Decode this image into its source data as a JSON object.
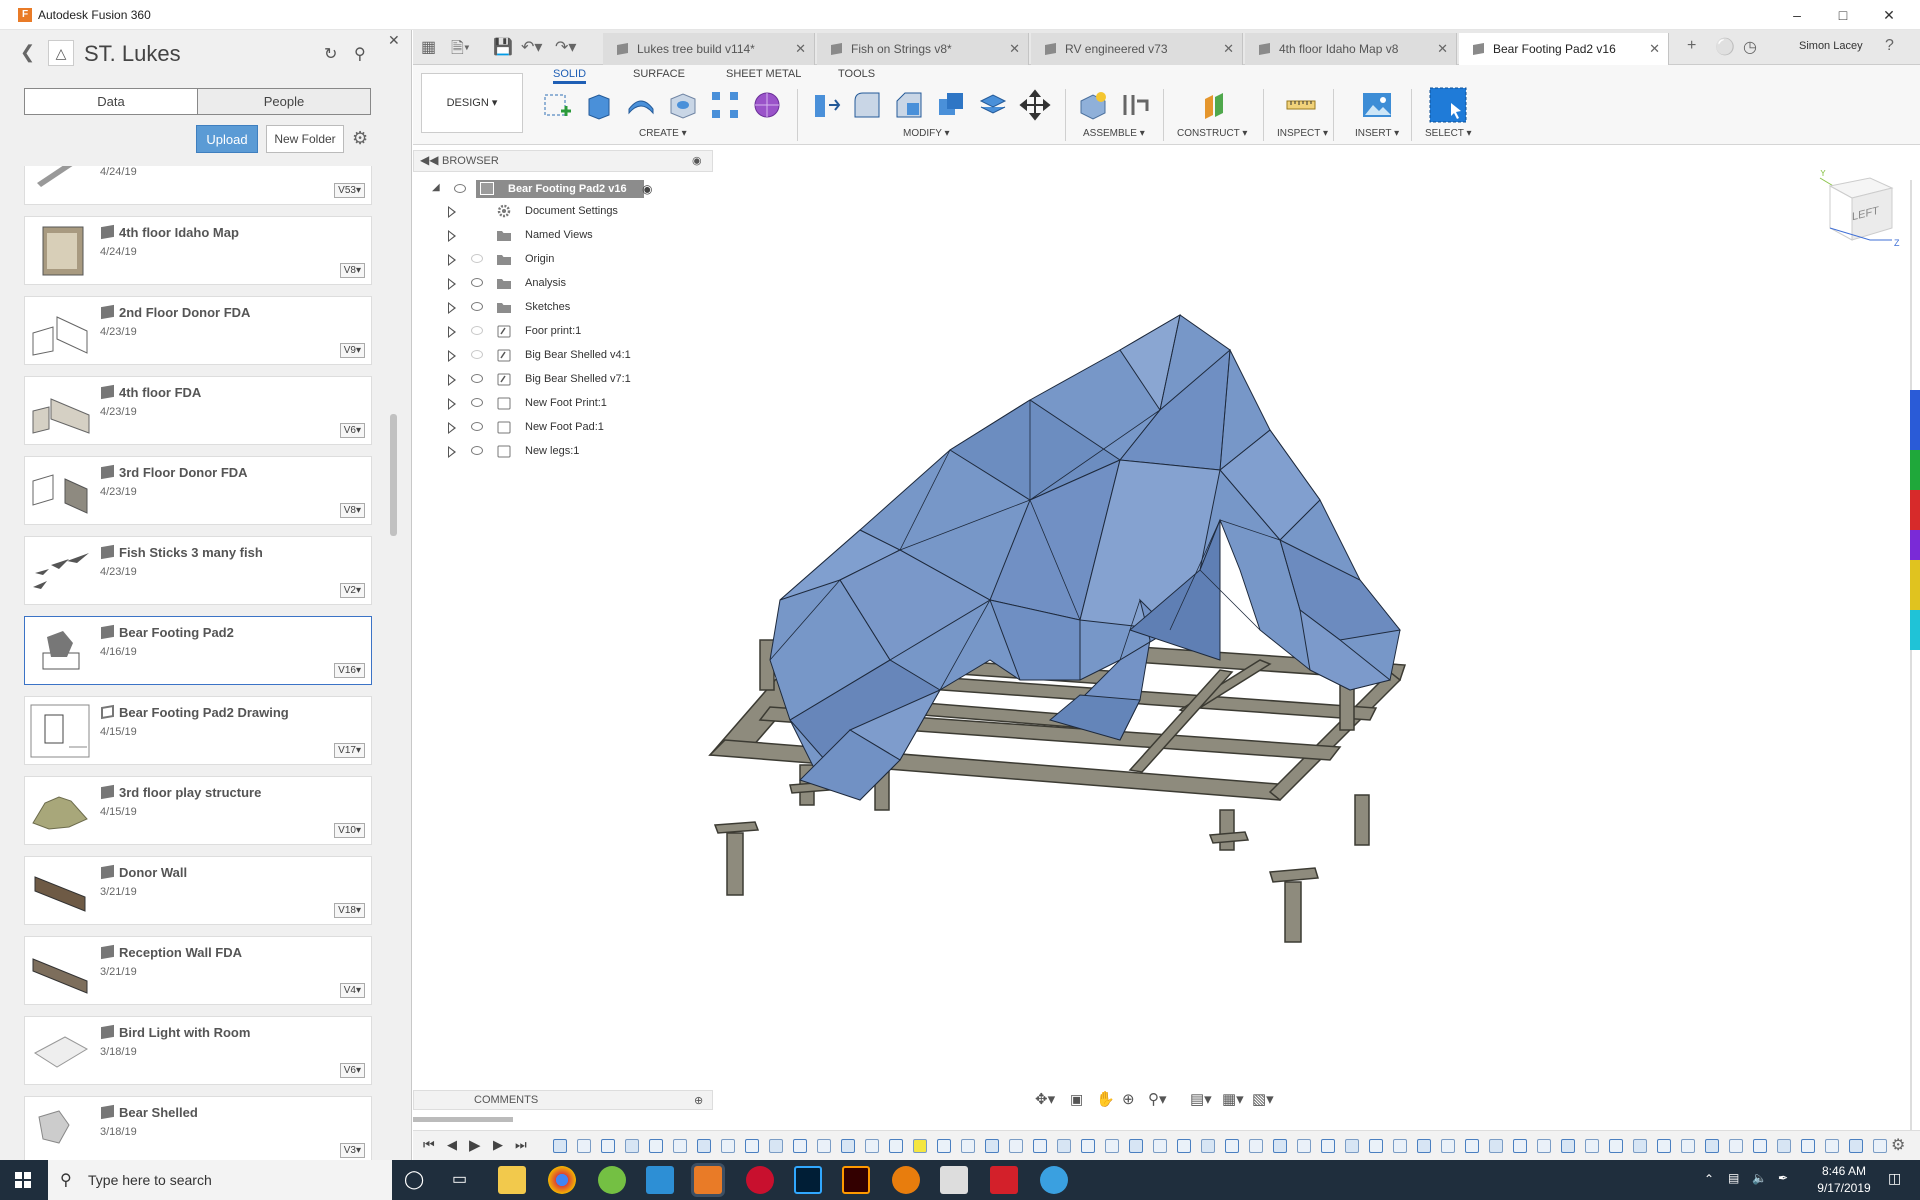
{
  "window": {
    "title": "Autodesk Fusion 360",
    "logo": "F"
  },
  "data_panel": {
    "project": "ST. Lukes",
    "segments": [
      "Data",
      "People"
    ],
    "upload_label": "Upload",
    "new_folder_label": "New Folder",
    "items": [
      {
        "name": "",
        "date": "4/24/19",
        "version": "V53"
      },
      {
        "name": "4th floor Idaho Map",
        "date": "4/24/19",
        "version": "V8"
      },
      {
        "name": "2nd Floor Donor FDA",
        "date": "4/23/19",
        "version": "V9"
      },
      {
        "name": "4th floor FDA",
        "date": "4/23/19",
        "version": "V6"
      },
      {
        "name": "3rd Floor Donor FDA",
        "date": "4/23/19",
        "version": "V8"
      },
      {
        "name": "Fish Sticks 3 many fish",
        "date": "4/23/19",
        "version": "V2"
      },
      {
        "name": "Bear Footing Pad2",
        "date": "4/16/19",
        "version": "V16"
      },
      {
        "name": "Bear Footing Pad2 Drawing",
        "date": "4/15/19",
        "version": "V17"
      },
      {
        "name": "3rd floor play structure",
        "date": "4/15/19",
        "version": "V10"
      },
      {
        "name": "Donor Wall",
        "date": "3/21/19",
        "version": "V18"
      },
      {
        "name": "Reception Wall FDA",
        "date": "3/21/19",
        "version": "V4"
      },
      {
        "name": "Bird Light with Room",
        "date": "3/18/19",
        "version": "V6"
      },
      {
        "name": "Bear Shelled",
        "date": "3/18/19",
        "version": "V3"
      }
    ]
  },
  "tabs": [
    {
      "label": "Lukes tree build v114*"
    },
    {
      "label": "Fish on Strings v8*"
    },
    {
      "label": "RV engineered v73"
    },
    {
      "label": "4th floor Idaho Map v8"
    },
    {
      "label": "Bear Footing Pad2 v16"
    }
  ],
  "user": "Simon Lacey",
  "ribbon": {
    "workspace": "DESIGN ▾",
    "tabs": [
      "SOLID",
      "SURFACE",
      "SHEET METAL",
      "TOOLS"
    ],
    "groups": [
      "CREATE ▾",
      "MODIFY ▾",
      "ASSEMBLE ▾",
      "CONSTRUCT ▾",
      "INSPECT ▾",
      "INSERT ▾",
      "SELECT ▾"
    ]
  },
  "browser": {
    "title": "BROWSER",
    "root": "Bear Footing Pad2 v16",
    "nodes": [
      {
        "label": "Document Settings",
        "icon": "gear-icon",
        "eye": "none"
      },
      {
        "label": "Named Views",
        "icon": "folder-icon",
        "eye": "none"
      },
      {
        "label": "Origin",
        "icon": "folder-icon",
        "eye": "off"
      },
      {
        "label": "Analysis",
        "icon": "folder-icon",
        "eye": "on"
      },
      {
        "label": "Sketches",
        "icon": "folder-icon",
        "eye": "on"
      },
      {
        "label": "Foor print:1",
        "icon": "component-link-icon",
        "eye": "off"
      },
      {
        "label": "Big Bear Shelled v4:1",
        "icon": "component-link-icon",
        "eye": "off"
      },
      {
        "label": "Big Bear Shelled v7:1",
        "icon": "component-link-icon",
        "eye": "on"
      },
      {
        "label": "New Foot Print:1",
        "icon": "component-icon",
        "eye": "on"
      },
      {
        "label": "New Foot Pad:1",
        "icon": "component-icon",
        "eye": "on"
      },
      {
        "label": "New legs:1",
        "icon": "component-icon",
        "eye": "on"
      }
    ]
  },
  "viewcube_face": "LEFT",
  "comments_label": "COMMENTS",
  "taskbar": {
    "search_placeholder": "Type here to search",
    "time": "8:46 AM",
    "date": "9/17/2019"
  },
  "colors": {
    "accent": "#1f5fb5",
    "model_blue": "#7797c8",
    "frame_grey": "#8b8b80",
    "taskbar": "#1f2e3d"
  }
}
